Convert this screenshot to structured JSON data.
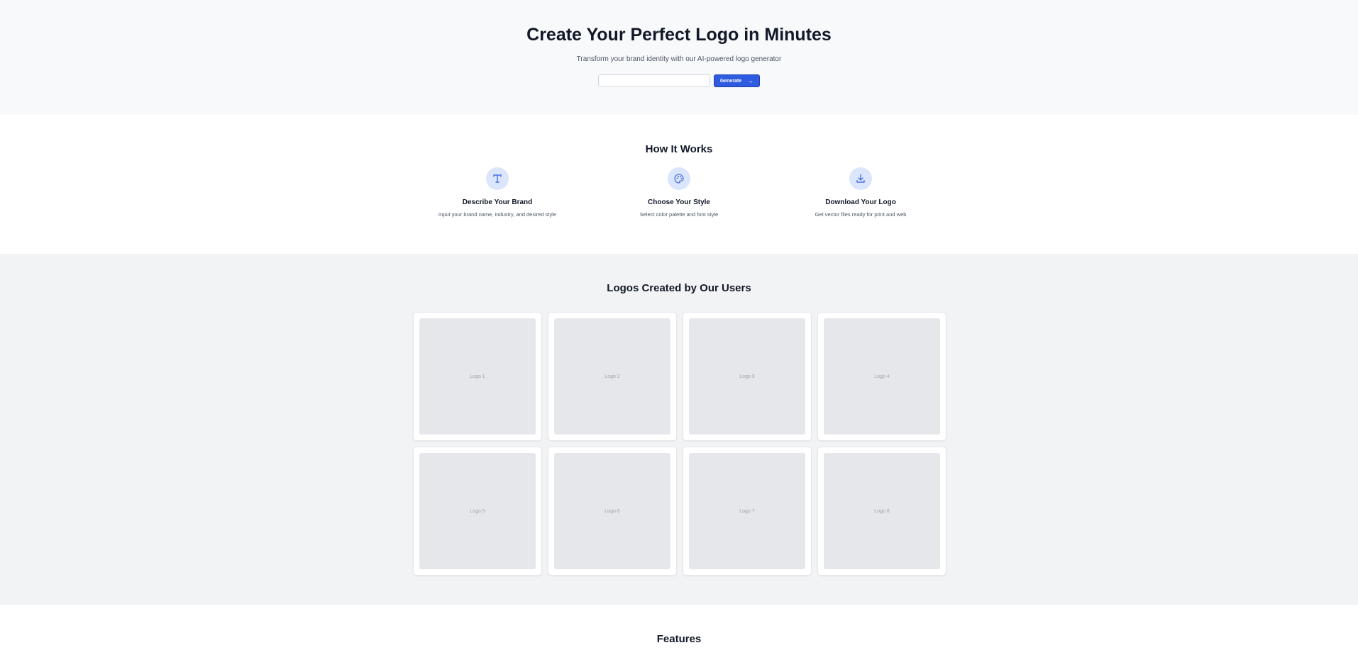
{
  "hero": {
    "title": "Create Your Perfect Logo in Minutes",
    "subtitle": "Transform your brand identity with our AI-powered logo generator",
    "input_placeholder": "",
    "generate_label": "Generate",
    "arrow_icon": "arrow-right-icon"
  },
  "how_it_works": {
    "title": "How It Works",
    "steps": [
      {
        "icon": "type-icon",
        "title": "Describe Your Brand",
        "text": "Input your brand name, industry, and desired style"
      },
      {
        "icon": "palette-icon",
        "title": "Choose Your Style",
        "text": "Select color palette and font style"
      },
      {
        "icon": "download-icon",
        "title": "Download Your Logo",
        "text": "Get vector files ready for print and web"
      }
    ]
  },
  "gallery": {
    "title": "Logos Created by Our Users",
    "logos": [
      "Logo 1",
      "Logo 2",
      "Logo 3",
      "Logo 4",
      "Logo 5",
      "Logo 6",
      "Logo 7",
      "Logo 8"
    ]
  },
  "features": {
    "title": "Features"
  },
  "colors": {
    "accent": "#2f5be0",
    "icon_bg": "#dbe5fb",
    "hero_bg": "#f8f9fb",
    "gallery_bg": "#f2f3f5"
  }
}
